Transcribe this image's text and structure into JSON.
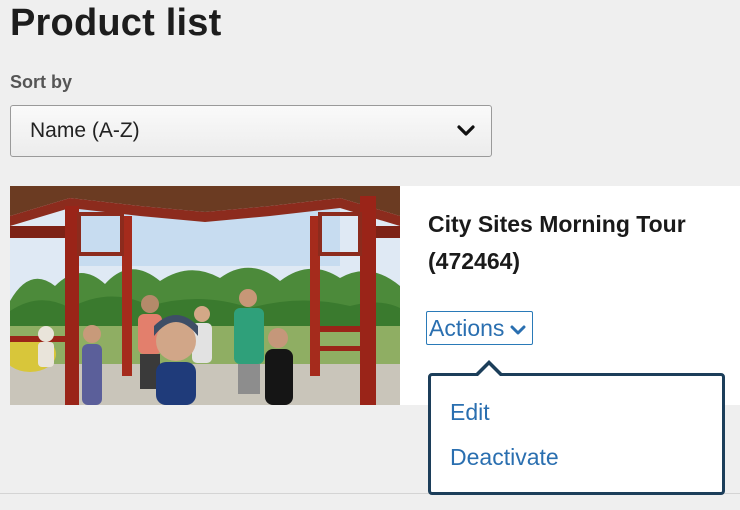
{
  "page": {
    "title": "Product list"
  },
  "sort": {
    "label": "Sort by",
    "selected": "Name (A-Z)",
    "icon": "chevron-down-icon"
  },
  "product": {
    "name": "City Sites Morning Tour (472464)",
    "image_alt": "Group of cyclists posing under a red Chinese-style pavilion",
    "actions_label": "Actions",
    "menu": {
      "items": [
        "Edit",
        "Deactivate"
      ]
    }
  },
  "colors": {
    "link": "#2a6fb0",
    "menu_border": "#1c3e5a",
    "background": "#efefef"
  }
}
